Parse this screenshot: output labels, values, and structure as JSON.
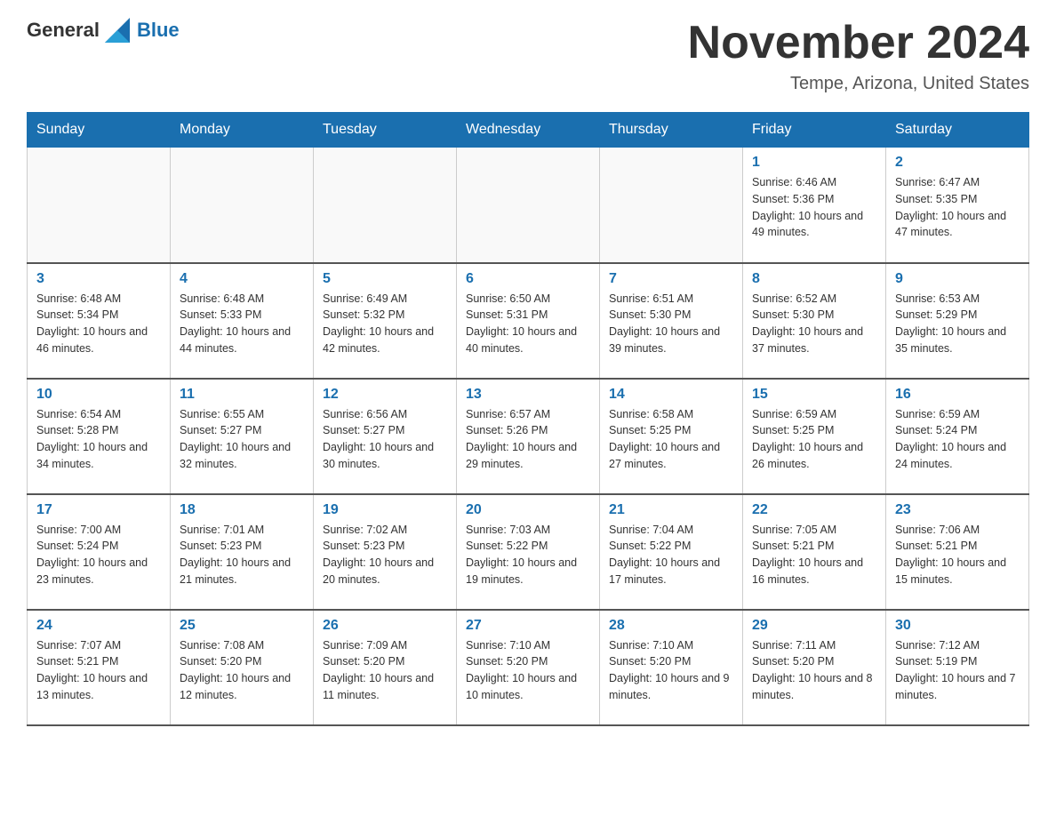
{
  "header": {
    "logo_general": "General",
    "logo_blue": "Blue",
    "month_title": "November 2024",
    "location": "Tempe, Arizona, United States"
  },
  "days_of_week": [
    "Sunday",
    "Monday",
    "Tuesday",
    "Wednesday",
    "Thursday",
    "Friday",
    "Saturday"
  ],
  "weeks": [
    [
      {
        "day": "",
        "sunrise": "",
        "sunset": "",
        "daylight": ""
      },
      {
        "day": "",
        "sunrise": "",
        "sunset": "",
        "daylight": ""
      },
      {
        "day": "",
        "sunrise": "",
        "sunset": "",
        "daylight": ""
      },
      {
        "day": "",
        "sunrise": "",
        "sunset": "",
        "daylight": ""
      },
      {
        "day": "",
        "sunrise": "",
        "sunset": "",
        "daylight": ""
      },
      {
        "day": "1",
        "sunrise": "Sunrise: 6:46 AM",
        "sunset": "Sunset: 5:36 PM",
        "daylight": "Daylight: 10 hours and 49 minutes."
      },
      {
        "day": "2",
        "sunrise": "Sunrise: 6:47 AM",
        "sunset": "Sunset: 5:35 PM",
        "daylight": "Daylight: 10 hours and 47 minutes."
      }
    ],
    [
      {
        "day": "3",
        "sunrise": "Sunrise: 6:48 AM",
        "sunset": "Sunset: 5:34 PM",
        "daylight": "Daylight: 10 hours and 46 minutes."
      },
      {
        "day": "4",
        "sunrise": "Sunrise: 6:48 AM",
        "sunset": "Sunset: 5:33 PM",
        "daylight": "Daylight: 10 hours and 44 minutes."
      },
      {
        "day": "5",
        "sunrise": "Sunrise: 6:49 AM",
        "sunset": "Sunset: 5:32 PM",
        "daylight": "Daylight: 10 hours and 42 minutes."
      },
      {
        "day": "6",
        "sunrise": "Sunrise: 6:50 AM",
        "sunset": "Sunset: 5:31 PM",
        "daylight": "Daylight: 10 hours and 40 minutes."
      },
      {
        "day": "7",
        "sunrise": "Sunrise: 6:51 AM",
        "sunset": "Sunset: 5:30 PM",
        "daylight": "Daylight: 10 hours and 39 minutes."
      },
      {
        "day": "8",
        "sunrise": "Sunrise: 6:52 AM",
        "sunset": "Sunset: 5:30 PM",
        "daylight": "Daylight: 10 hours and 37 minutes."
      },
      {
        "day": "9",
        "sunrise": "Sunrise: 6:53 AM",
        "sunset": "Sunset: 5:29 PM",
        "daylight": "Daylight: 10 hours and 35 minutes."
      }
    ],
    [
      {
        "day": "10",
        "sunrise": "Sunrise: 6:54 AM",
        "sunset": "Sunset: 5:28 PM",
        "daylight": "Daylight: 10 hours and 34 minutes."
      },
      {
        "day": "11",
        "sunrise": "Sunrise: 6:55 AM",
        "sunset": "Sunset: 5:27 PM",
        "daylight": "Daylight: 10 hours and 32 minutes."
      },
      {
        "day": "12",
        "sunrise": "Sunrise: 6:56 AM",
        "sunset": "Sunset: 5:27 PM",
        "daylight": "Daylight: 10 hours and 30 minutes."
      },
      {
        "day": "13",
        "sunrise": "Sunrise: 6:57 AM",
        "sunset": "Sunset: 5:26 PM",
        "daylight": "Daylight: 10 hours and 29 minutes."
      },
      {
        "day": "14",
        "sunrise": "Sunrise: 6:58 AM",
        "sunset": "Sunset: 5:25 PM",
        "daylight": "Daylight: 10 hours and 27 minutes."
      },
      {
        "day": "15",
        "sunrise": "Sunrise: 6:59 AM",
        "sunset": "Sunset: 5:25 PM",
        "daylight": "Daylight: 10 hours and 26 minutes."
      },
      {
        "day": "16",
        "sunrise": "Sunrise: 6:59 AM",
        "sunset": "Sunset: 5:24 PM",
        "daylight": "Daylight: 10 hours and 24 minutes."
      }
    ],
    [
      {
        "day": "17",
        "sunrise": "Sunrise: 7:00 AM",
        "sunset": "Sunset: 5:24 PM",
        "daylight": "Daylight: 10 hours and 23 minutes."
      },
      {
        "day": "18",
        "sunrise": "Sunrise: 7:01 AM",
        "sunset": "Sunset: 5:23 PM",
        "daylight": "Daylight: 10 hours and 21 minutes."
      },
      {
        "day": "19",
        "sunrise": "Sunrise: 7:02 AM",
        "sunset": "Sunset: 5:23 PM",
        "daylight": "Daylight: 10 hours and 20 minutes."
      },
      {
        "day": "20",
        "sunrise": "Sunrise: 7:03 AM",
        "sunset": "Sunset: 5:22 PM",
        "daylight": "Daylight: 10 hours and 19 minutes."
      },
      {
        "day": "21",
        "sunrise": "Sunrise: 7:04 AM",
        "sunset": "Sunset: 5:22 PM",
        "daylight": "Daylight: 10 hours and 17 minutes."
      },
      {
        "day": "22",
        "sunrise": "Sunrise: 7:05 AM",
        "sunset": "Sunset: 5:21 PM",
        "daylight": "Daylight: 10 hours and 16 minutes."
      },
      {
        "day": "23",
        "sunrise": "Sunrise: 7:06 AM",
        "sunset": "Sunset: 5:21 PM",
        "daylight": "Daylight: 10 hours and 15 minutes."
      }
    ],
    [
      {
        "day": "24",
        "sunrise": "Sunrise: 7:07 AM",
        "sunset": "Sunset: 5:21 PM",
        "daylight": "Daylight: 10 hours and 13 minutes."
      },
      {
        "day": "25",
        "sunrise": "Sunrise: 7:08 AM",
        "sunset": "Sunset: 5:20 PM",
        "daylight": "Daylight: 10 hours and 12 minutes."
      },
      {
        "day": "26",
        "sunrise": "Sunrise: 7:09 AM",
        "sunset": "Sunset: 5:20 PM",
        "daylight": "Daylight: 10 hours and 11 minutes."
      },
      {
        "day": "27",
        "sunrise": "Sunrise: 7:10 AM",
        "sunset": "Sunset: 5:20 PM",
        "daylight": "Daylight: 10 hours and 10 minutes."
      },
      {
        "day": "28",
        "sunrise": "Sunrise: 7:10 AM",
        "sunset": "Sunset: 5:20 PM",
        "daylight": "Daylight: 10 hours and 9 minutes."
      },
      {
        "day": "29",
        "sunrise": "Sunrise: 7:11 AM",
        "sunset": "Sunset: 5:20 PM",
        "daylight": "Daylight: 10 hours and 8 minutes."
      },
      {
        "day": "30",
        "sunrise": "Sunrise: 7:12 AM",
        "sunset": "Sunset: 5:19 PM",
        "daylight": "Daylight: 10 hours and 7 minutes."
      }
    ]
  ]
}
